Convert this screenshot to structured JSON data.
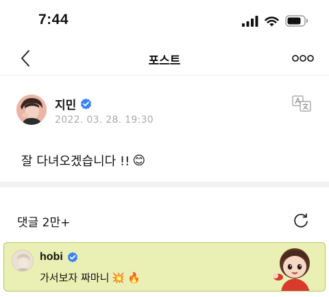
{
  "status_bar": {
    "time": "7:44"
  },
  "nav": {
    "title": "포스트"
  },
  "post": {
    "author": "지민",
    "date": "2022. 03. 28. 19:30",
    "body_text": "잘 다녀오겠습니다 !!",
    "body_emoji": "😊"
  },
  "comments": {
    "count_label": "댓글 2만+",
    "items": [
      {
        "author": "hobi",
        "text": "가서보자 짜마니",
        "emoji_1": "💥",
        "emoji_2": "🔥"
      }
    ]
  },
  "colors": {
    "verified_badge": "#3b82f6",
    "comment_highlight_bg": "#eaf0b4",
    "comment_highlight_border": "#b8c46a",
    "date_text": "#a9a9a9",
    "divider": "#f1f1f3"
  },
  "icons": {
    "back": "chevron-left-icon",
    "more": "more-dots-icon",
    "translate": "translate-icon",
    "refresh": "refresh-icon",
    "verified": "verified-badge-icon",
    "signal": "signal-icon",
    "wifi": "wifi-icon",
    "battery": "battery-icon"
  }
}
